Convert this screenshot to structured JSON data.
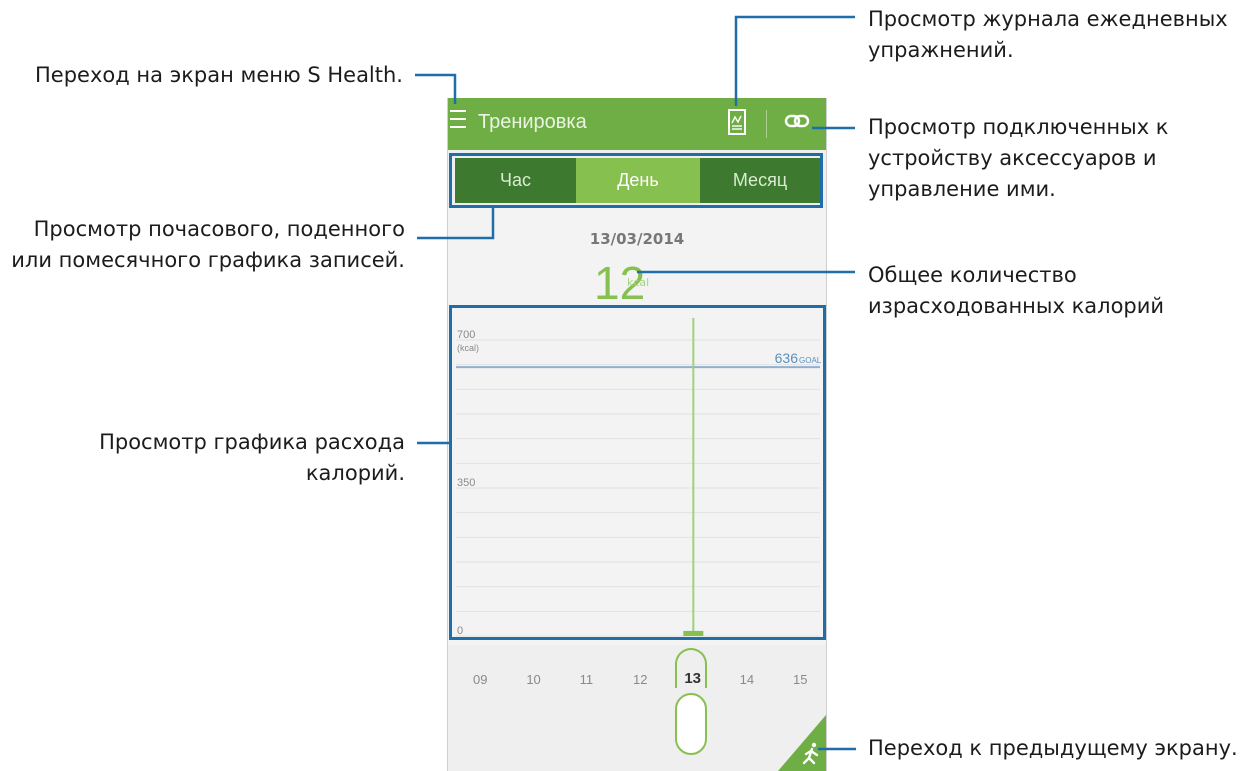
{
  "app": {
    "title": "Тренировка",
    "tabs": [
      {
        "label": "Час",
        "selected": false
      },
      {
        "label": "День",
        "selected": true
      },
      {
        "label": "Месяц",
        "selected": false
      }
    ],
    "date": "13/03/2014",
    "total_calories": "12",
    "total_calories_unit": "kcal",
    "icons": {
      "menu": "menu-icon",
      "log": "exercise-log-icon",
      "accessories": "link-icon",
      "back": "running-icon"
    }
  },
  "chart_data": {
    "type": "bar",
    "ylabel": "(kcal)",
    "ylim": [
      0,
      700
    ],
    "y_ticks": [
      "700",
      "350",
      "0"
    ],
    "categories": [
      "09",
      "10",
      "11",
      "12",
      "13",
      "14",
      "15"
    ],
    "selected_category": "13",
    "values": [
      0,
      0,
      0,
      0,
      12,
      0,
      0
    ],
    "goal": {
      "value": 636,
      "label": "636",
      "suffix": "GOAL"
    }
  },
  "callouts": {
    "menu": "Переход на экран меню S Health.",
    "log_line1": "Просмотр журнала ежедневных",
    "log_line2": "упражнений.",
    "accessories_line1": "Просмотр подключенных к",
    "accessories_line2": "устройству аксессуаров и",
    "accessories_line3": "управление ими.",
    "period_line1": "Просмотр почасового, поденного",
    "period_line2": "или помесячного графика записей.",
    "calories_line1": "Общее количество",
    "calories_line2": "израсходованных калорий",
    "graph_line1": "Просмотр графика расхода",
    "graph_line2": "калорий.",
    "back": "Переход к предыдущему экрану."
  },
  "colors": {
    "appbar": "#6fae44",
    "tab_bg": "#3d7a30",
    "tab_active": "#86c04f",
    "accent": "#86c04f",
    "goal_line": "#5b8fbf",
    "leader": "#1f6ea8"
  }
}
